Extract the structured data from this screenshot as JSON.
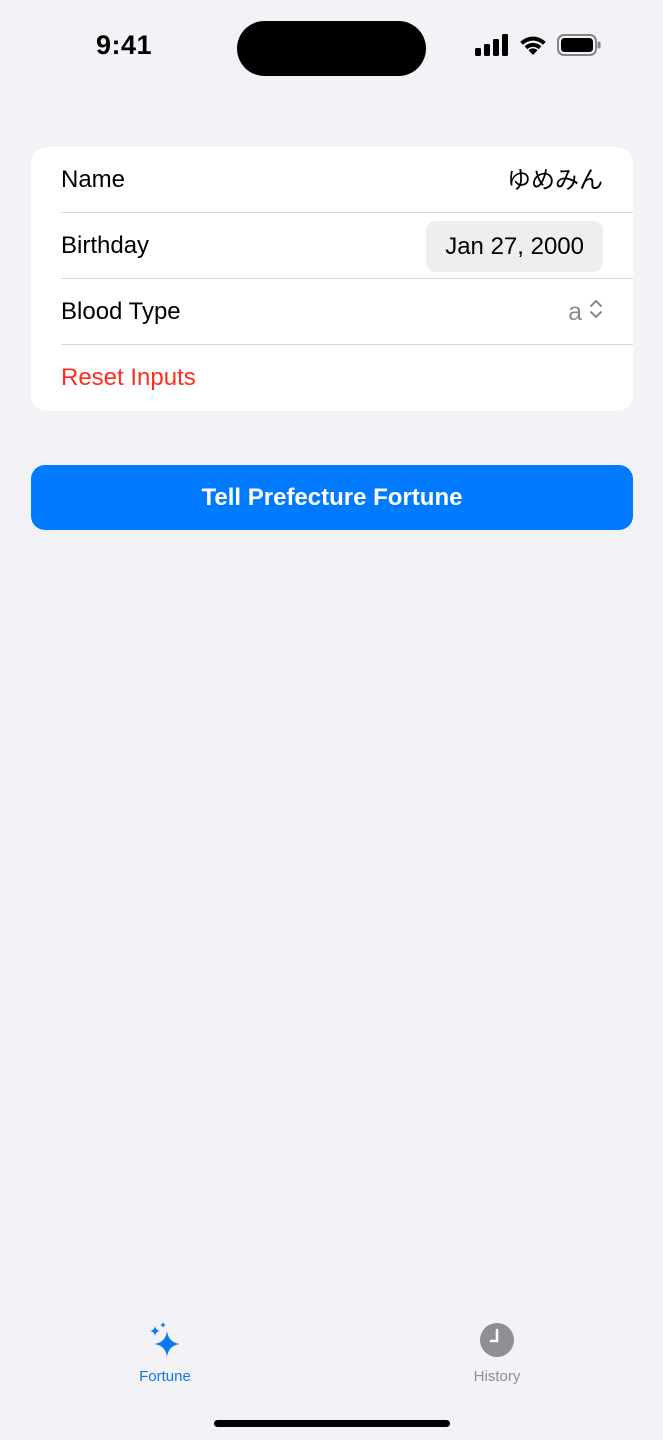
{
  "status_bar": {
    "time": "9:41",
    "icons": [
      "cellular-signal-icon",
      "wifi-icon",
      "battery-icon"
    ]
  },
  "form": {
    "name": {
      "label": "Name",
      "value": "ゆめみん"
    },
    "birthday": {
      "label": "Birthday",
      "value": "Jan 27, 2000"
    },
    "blood_type": {
      "label": "Blood Type",
      "value": "a",
      "icon": "chevron-up-down-icon"
    },
    "reset": {
      "label": "Reset Inputs"
    }
  },
  "actions": {
    "tell_fortune_label": "Tell Prefecture Fortune"
  },
  "tab_bar": {
    "tabs": [
      {
        "label": "Fortune",
        "icon": "sparkles-icon",
        "selected": true
      },
      {
        "label": "History",
        "icon": "clock-icon",
        "selected": false
      }
    ]
  },
  "colors": {
    "accent": "#007aff",
    "destructive": "#ff2d1f",
    "background": "#f2f2f7",
    "card": "#ffffff",
    "inactive": "#8e8e93"
  }
}
